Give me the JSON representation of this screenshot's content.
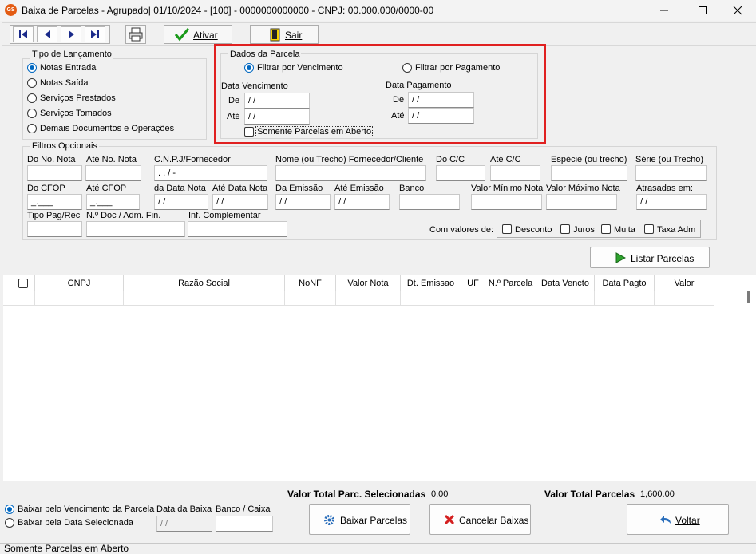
{
  "window": {
    "title": "Baixa de Parcelas - Agrupado|  01/10/2024 - [100] - 0000000000000 - CNPJ: 00.000.000/0000-00",
    "app_icon_text": "GS",
    "minimize_icon": "minimize-icon",
    "maximize_icon": "maximize-icon",
    "close_icon": "close-icon"
  },
  "toolbar": {
    "ativar_label": "Ativar",
    "sair_label": "Sair"
  },
  "tipo_lancamento": {
    "legend": "Tipo de Lançamento",
    "options": [
      "Notas Entrada",
      "Notas Saída",
      "Serviços Prestados",
      "Serviços Tomados",
      "Demais Documentos e Operações"
    ],
    "selected": "Notas Entrada"
  },
  "dados_parcela": {
    "legend": "Dados da Parcela",
    "filter_vencimento": "Filtrar por Vencimento",
    "filter_pagamento": "Filtrar por Pagamento",
    "data_vencimento_label": "Data Vencimento",
    "data_pagamento_label": "Data Pagamento",
    "de_label": "De",
    "ate_label": "Até",
    "date_mask": " / /",
    "somente_aberto": "Somente Parcelas em Aberto"
  },
  "filtros": {
    "legend": "Filtros Opcionais",
    "do_no_nota": "Do No. Nota",
    "ate_no_nota": "Até No. Nota",
    "cnpj_fornecedor": "C.N.P.J/Fornecedor",
    "cnpj_mask": " .  .  /  -",
    "nome_fornecedor": "Nome (ou Trecho)  Fornecedor/Cliente",
    "do_cc": "Do C/C",
    "ate_cc": "Até C/C",
    "especie": "Espécie (ou trecho)",
    "serie": "Série (ou Trecho)",
    "do_cfop": "Do CFOP",
    "ate_cfop": "Até CFOP",
    "cfop_mask": "_.___",
    "da_data_nota": "da Data Nota",
    "ate_data_nota": "Até Data Nota",
    "da_emissao": "Da Emissão",
    "ate_emissao": "Até Emissão",
    "banco": "Banco",
    "valor_minimo": "Valor Mínimo Nota",
    "valor_maximo": "Valor Máximo Nota",
    "atrasadas": "Atrasadas em:",
    "tipo_pag": "Tipo Pag/Rec",
    "no_doc": "N.º Doc / Adm. Fin.",
    "inf_complementar": "Inf. Complementar",
    "com_valores": "Com valores de:",
    "desconto": "Desconto",
    "juros": "Juros",
    "multa": "Multa",
    "taxa_adm": "Taxa Adm",
    "date_mask": " / /"
  },
  "listar_label": "Listar Parcelas",
  "grid": {
    "columns": [
      "CNPJ",
      "Razão Social",
      "NoNF",
      "Valor Nota",
      "Dt. Emissao",
      "UF",
      "N.º Parcela",
      "Data Vencto",
      "Data Pagto",
      "Valor"
    ]
  },
  "bottom": {
    "valor_selecionadas_label": "Valor Total Parc. Selecionadas",
    "valor_selecionadas_value": "0.00",
    "valor_total_label": "Valor Total Parcelas",
    "valor_total_value": "1,600.00",
    "baixar_vencimento": "Baixar pelo Vencimento da Parcela",
    "baixar_data": "Baixar pela Data Selecionada",
    "data_baixa_label": "Data da Baixa",
    "data_baixa_value": " / /",
    "banco_caixa_label": "Banco / Caixa",
    "baixar_parcelas": "Baixar Parcelas",
    "cancelar_baixas": "Cancelar Baixas",
    "voltar": "Voltar"
  },
  "status": {
    "text": "Somente Parcelas em Aberto"
  }
}
